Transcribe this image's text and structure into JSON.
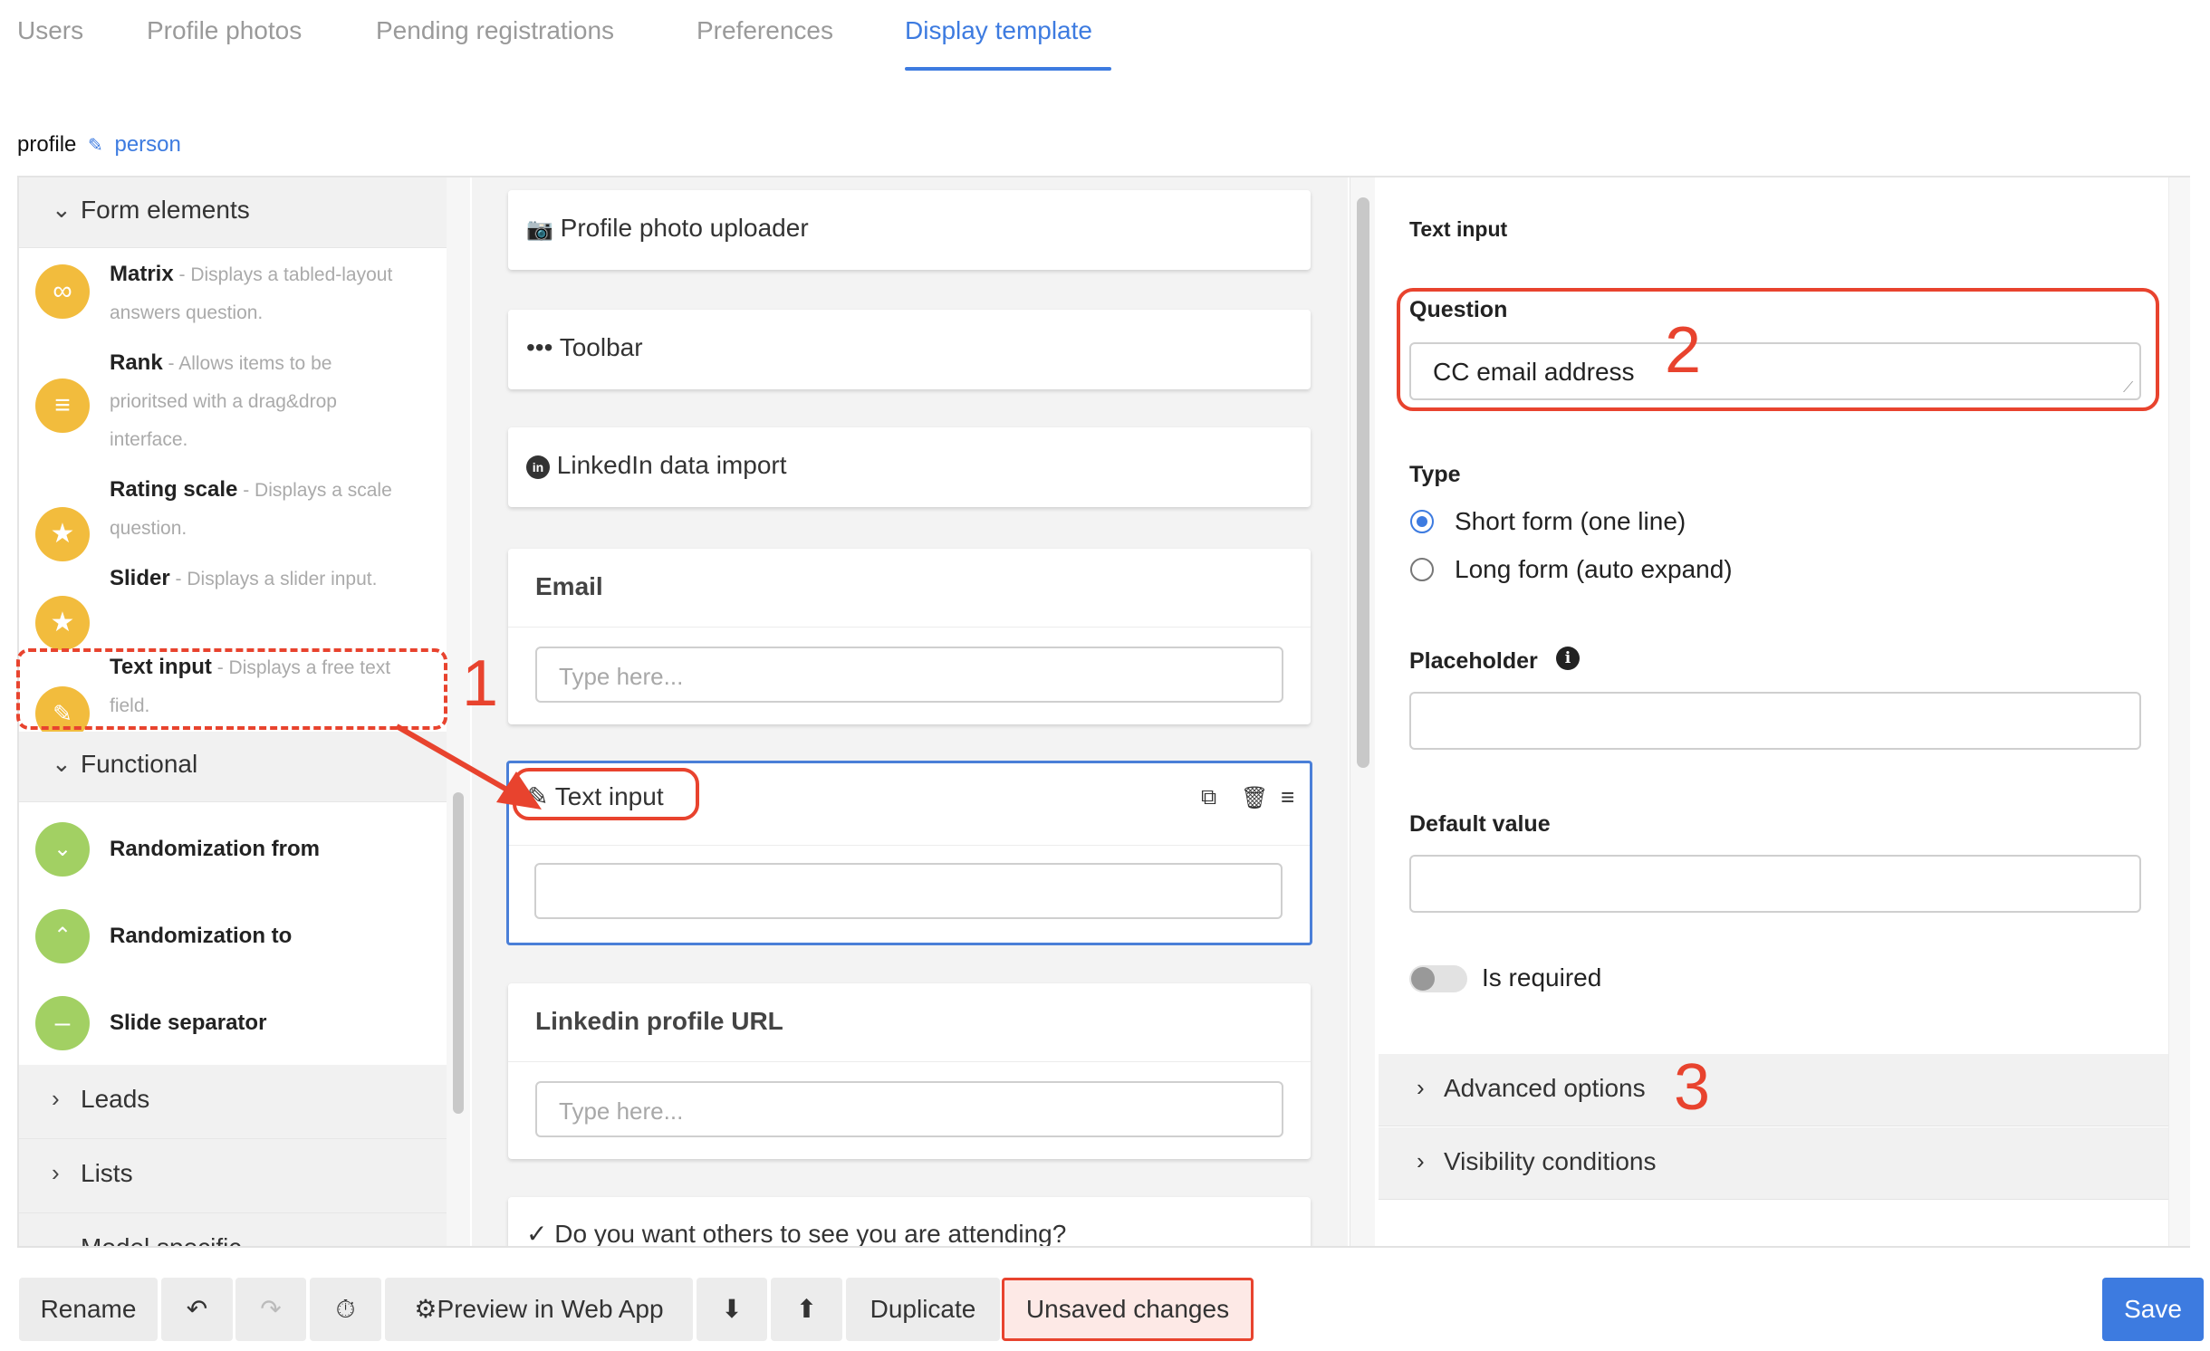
{
  "tabs": [
    {
      "label": "Users"
    },
    {
      "label": "Profile photos"
    },
    {
      "label": "Pending registrations"
    },
    {
      "label": "Preferences"
    },
    {
      "label": "Display template"
    }
  ],
  "breadcrumb": {
    "model": "profile",
    "view": "person"
  },
  "left_panel": {
    "form_elements_header": "Form elements",
    "elements": [
      {
        "name": "Matrix",
        "desc": " - Displays a tabled-layout answers question.",
        "icon": "infinity-icon"
      },
      {
        "name": "Rank",
        "desc": " - Allows items to be prioritsed with a drag&drop interface.",
        "icon": "list-icon"
      },
      {
        "name": "Rating scale",
        "desc": " - Displays a scale question.",
        "icon": "star-icon"
      },
      {
        "name": "Slider",
        "desc": " - Displays a slider input.",
        "icon": "star-icon"
      },
      {
        "name": "Text input",
        "desc": " - Displays a free text field.",
        "icon": "edit-icon"
      }
    ],
    "functional_header": "Functional",
    "functional": [
      {
        "label": "Randomization from",
        "icon": "chevron-down-icon"
      },
      {
        "label": "Randomization to",
        "icon": "chevron-up-icon"
      },
      {
        "label": "Slide separator",
        "icon": "minus-icon"
      }
    ],
    "leads_header": "Leads",
    "lists_header": "Lists",
    "model_specific_header": "Model specific"
  },
  "canvas": {
    "cards": {
      "photo": "Profile photo uploader",
      "toolbar": "Toolbar",
      "linkedin_import": "LinkedIn data import",
      "email_title": "Email",
      "email_placeholder": "Type here...",
      "text_input_title": "Text input",
      "linkedin_url_title": "Linkedin profile URL",
      "linkedin_url_placeholder": "Type here...",
      "attending": "Do you want others to see you are attending?"
    }
  },
  "right_panel": {
    "header": "Text input",
    "question_label": "Question",
    "question_value": "CC email address",
    "type_label": "Type",
    "type_options": [
      "Short form (one line)",
      "Long form (auto expand)"
    ],
    "type_selected": "Short form (one line)",
    "placeholder_label": "Placeholder",
    "placeholder_value": "",
    "default_label": "Default value",
    "default_value": "",
    "required_label": "Is required",
    "required": false,
    "advanced": "Advanced options",
    "visibility": "Visibility conditions"
  },
  "annotations": [
    "1",
    "2",
    "3"
  ],
  "bottom_toolbar": {
    "rename": "Rename",
    "preview": "Preview in Web App",
    "duplicate": "Duplicate",
    "unsaved": "Unsaved changes",
    "save": "Save"
  },
  "colors": {
    "accent": "#3d7be0",
    "annotation": "#e8432e",
    "yellow_icon": "#f2bc3d",
    "green_icon": "#a2d063"
  }
}
